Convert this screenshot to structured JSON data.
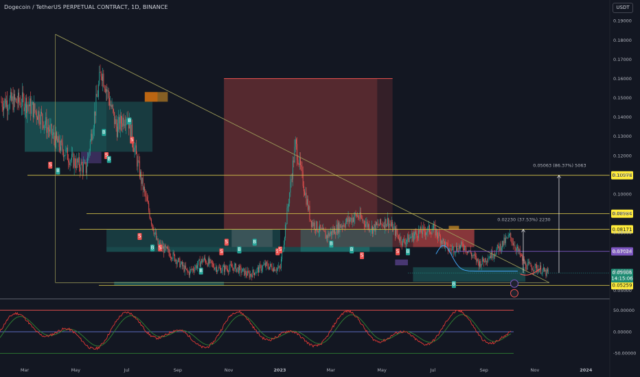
{
  "header": {
    "title": "Dogecoin / TetherUS PERPETUAL CONTRACT, 1D, BINANCE",
    "currency": "USDT"
  },
  "colors": {
    "background": "#131722",
    "bullish_candle": "#26a69a",
    "bearish_candle": "#ef5350",
    "trendline": "#9e9d5a",
    "level_line": "#d4c24a",
    "purple_level": "#7e57c2",
    "price_tag_yellow": "#ffeb3b",
    "price_tag_teal": "#1f8a72",
    "oscillator_line": "#e53935",
    "oscillator_signal": "#2e7d32"
  },
  "chart_data": [
    {
      "type": "candlestick",
      "title": "Dogecoin / TetherUS PERPETUAL CONTRACT, 1D, BINANCE",
      "x_ticks": [
        "Mar",
        "May",
        "Jul",
        "Sep",
        "Nov",
        "2023",
        "Mar",
        "May",
        "Jul",
        "Sep",
        "Nov",
        "2024"
      ],
      "y_ticks": [
        "0.19000",
        "0.18000",
        "0.17000",
        "0.16000",
        "0.15000",
        "0.14000",
        "0.13000",
        "0.12000",
        "0.11000",
        "0.10978",
        "0.10000",
        "0.09000",
        "0.08984",
        "0.08171",
        "0.08000",
        "0.07024",
        "0.07000",
        "0.06000",
        "0.05906",
        "0.05259",
        "0.05000"
      ],
      "ylim": [
        0.047,
        0.193
      ],
      "price_path": {
        "x_month_index": [
          0,
          0.6,
          1.2,
          1.8,
          2.4,
          3.0,
          3.6,
          4.0,
          4.6,
          5.2,
          5.8,
          6.4,
          7.0,
          7.6,
          8.2,
          8.8,
          9.4,
          10.0,
          10.6,
          11.2,
          11.8,
          12.4,
          13.0,
          13.6,
          14.2,
          14.8,
          15.4,
          16.0,
          16.6,
          17.2,
          17.8,
          18.4,
          19.0,
          19.6,
          20.2,
          20.4
        ],
        "close": [
          0.148,
          0.141,
          0.128,
          0.118,
          0.113,
          0.165,
          0.134,
          0.142,
          0.105,
          0.074,
          0.068,
          0.059,
          0.066,
          0.061,
          0.062,
          0.058,
          0.063,
          0.061,
          0.126,
          0.086,
          0.078,
          0.084,
          0.089,
          0.082,
          0.086,
          0.075,
          0.08,
          0.082,
          0.071,
          0.073,
          0.064,
          0.07,
          0.078,
          0.063,
          0.061,
          0.059
        ]
      },
      "levels": [
        {
          "label": "0.10978",
          "value": 0.10978
        },
        {
          "label": "0.08984",
          "value": 0.08984
        },
        {
          "label": "0.08171",
          "value": 0.08171
        },
        {
          "label": "0.07024",
          "value": 0.07024
        },
        {
          "label": "0.05259",
          "value": 0.05259
        }
      ],
      "current_price": {
        "value": "0.05906",
        "countdown": "14:15:06"
      },
      "measurements": [
        {
          "label": "0.05063 (86.37%) 5063",
          "from": 0.05906,
          "to": 0.10978
        },
        {
          "label": "0.02230 (37.53%) 2230",
          "from": 0.05906,
          "to": 0.08171
        }
      ],
      "signal_labels": [
        "S",
        "B",
        "B",
        "S",
        "S",
        "B",
        "B",
        "S",
        "S",
        "B",
        "B",
        "S",
        "S",
        "B",
        "B",
        "S",
        "S",
        "B",
        "B",
        "S",
        "S",
        "B",
        "B"
      ]
    },
    {
      "type": "line",
      "name": "oscillator",
      "y_ticks": [
        "50.00000",
        "0.00000",
        "-50.00000"
      ],
      "ylim": [
        -70,
        70
      ],
      "levels": [
        50,
        0,
        -50
      ]
    }
  ]
}
